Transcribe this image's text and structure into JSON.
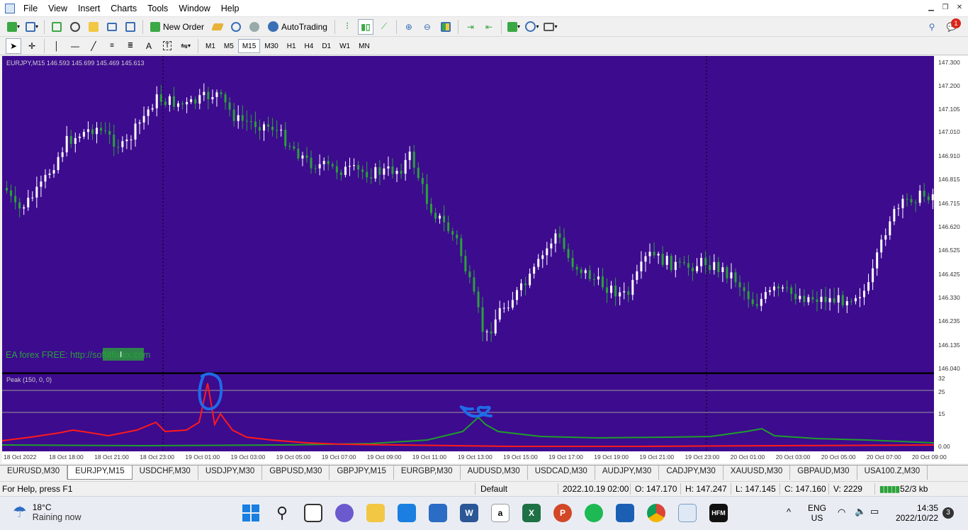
{
  "menu": [
    "File",
    "View",
    "Insert",
    "Charts",
    "Tools",
    "Window",
    "Help"
  ],
  "toolbar": {
    "new_order": "New Order",
    "autotrading": "AutoTrading"
  },
  "timeframes": [
    "M1",
    "M5",
    "M15",
    "M30",
    "H1",
    "H4",
    "D1",
    "W1",
    "MN"
  ],
  "active_timeframe": "M15",
  "chart": {
    "header": "EURJPY,M15  146.593 145.699 145.469 145.613",
    "watermark": "EA forex FREE: http://soft4forex.com",
    "indicator_label": "Peak (150, 0, 0)",
    "price_labels": [
      "147.300",
      "147.200",
      "147.105",
      "147.010",
      "146.910",
      "146.815",
      "146.715",
      "146.620",
      "146.525",
      "146.425",
      "146.330",
      "146.235",
      "146.135",
      "146.040"
    ],
    "indicator_levels": [
      "32",
      "25",
      "15",
      "0.00"
    ],
    "time_labels": [
      "18 Oct 2022",
      "18 Oct 18:00",
      "18 Oct 21:00",
      "18 Oct 23:00",
      "19 Oct 01:00",
      "19 Oct 03:00",
      "19 Oct 05:00",
      "19 Oct 07:00",
      "19 Oct 09:00",
      "19 Oct 11:00",
      "19 Oct 13:00",
      "19 Oct 15:00",
      "19 Oct 17:00",
      "19 Oct 19:00",
      "19 Oct 21:00",
      "19 Oct 23:00",
      "20 Oct 01:00",
      "20 Oct 03:00",
      "20 Oct 05:00",
      "20 Oct 07:00",
      "20 Oct 09:00"
    ],
    "colors": {
      "bg": "#3d0b8e",
      "bull": "#ffffff",
      "bear": "#2aa13a",
      "grid": "#000000",
      "red_line": "#ff1a1a",
      "green_line": "#1e9e2c",
      "annot": "#1f6be8"
    }
  },
  "symbol_tabs": [
    "EURUSD,M30",
    "EURJPY,M15",
    "USDCHF,M30",
    "USDJPY,M30",
    "GBPUSD,M30",
    "GBPJPY,M15",
    "EURGBP,M30",
    "AUDUSD,M30",
    "USDCAD,M30",
    "AUDJPY,M30",
    "CADJPY,M30",
    "XAUUSD,M30",
    "GBPAUD,M30",
    "USA100.Z,M30"
  ],
  "active_tab": "EURJPY,M15",
  "status": {
    "help": "For Help, press F1",
    "profile": "Default",
    "datetime": "2022.10.19 02:00",
    "open": "O: 147.170",
    "high": "H: 147.247",
    "low": "L: 147.145",
    "close": "C: 147.160",
    "volume": "V: 2229",
    "traffic": "52/3 kb"
  },
  "taskbar": {
    "temp": "18°C",
    "condition": "Raining now",
    "lang1": "ENG",
    "lang2": "US",
    "time": "14:35",
    "date": "2022/10/22",
    "notifications": "3"
  }
}
